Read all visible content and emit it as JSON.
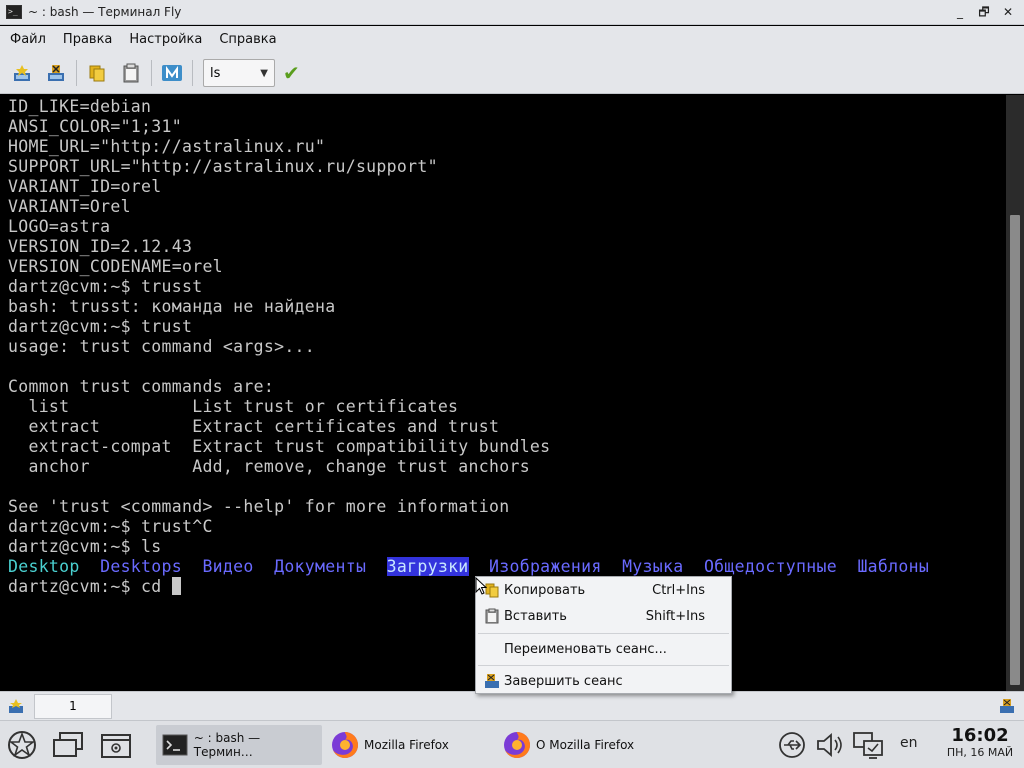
{
  "window": {
    "title": "~ : bash — Терминал Fly",
    "minimize": "_",
    "maximize": "🗗",
    "close": "✕"
  },
  "menu": [
    "Файл",
    "Правка",
    "Настройка",
    "Справка"
  ],
  "toolbar": {
    "command_value": "ls"
  },
  "terminal": {
    "lines": [
      "ID_LIKE=debian",
      "ANSI_COLOR=\"1;31\"",
      "HOME_URL=\"http://astralinux.ru\"",
      "SUPPORT_URL=\"http://astralinux.ru/support\"",
      "VARIANT_ID=orel",
      "VARIANT=Orel",
      "LOGO=astra",
      "VERSION_ID=2.12.43",
      "VERSION_CODENAME=orel",
      "dartz@cvm:~$ trusst",
      "bash: trusst: команда не найдена",
      "dartz@cvm:~$ trust",
      "usage: trust command <args>...",
      "",
      "Common trust commands are:",
      "  list            List trust or certificates",
      "  extract         Extract certificates and trust",
      "  extract-compat  Extract trust compatibility bundles",
      "  anchor          Add, remove, change trust anchors",
      "",
      "See 'trust <command> --help' for more information",
      "dartz@cvm:~$ trust^C",
      "dartz@cvm:~$ ls"
    ],
    "ls_entries": [
      "Desktop",
      "Desktops",
      "Видео",
      "Документы",
      "Загрузки",
      "Изображения",
      "Музыка",
      "Общедоступные",
      "Шаблоны"
    ],
    "prompt_line": "dartz@cvm:~$ cd "
  },
  "tabs": [
    {
      "label": "1"
    }
  ],
  "context_menu": {
    "copy": {
      "label": "Копировать",
      "shortcut": "Ctrl+Ins"
    },
    "paste": {
      "label": "Вставить",
      "shortcut": "Shift+Ins"
    },
    "rename": {
      "label": "Переименовать сеанс..."
    },
    "end": {
      "label": "Завершить сеанс"
    }
  },
  "taskbar": {
    "tasks": [
      {
        "label": "~ : bash — Термин…"
      },
      {
        "label": "Mozilla Firefox"
      },
      {
        "label": "О Mozilla Firefox"
      }
    ],
    "lang": "en",
    "time": "16:02",
    "date": "ПН, 16 МАЙ"
  }
}
